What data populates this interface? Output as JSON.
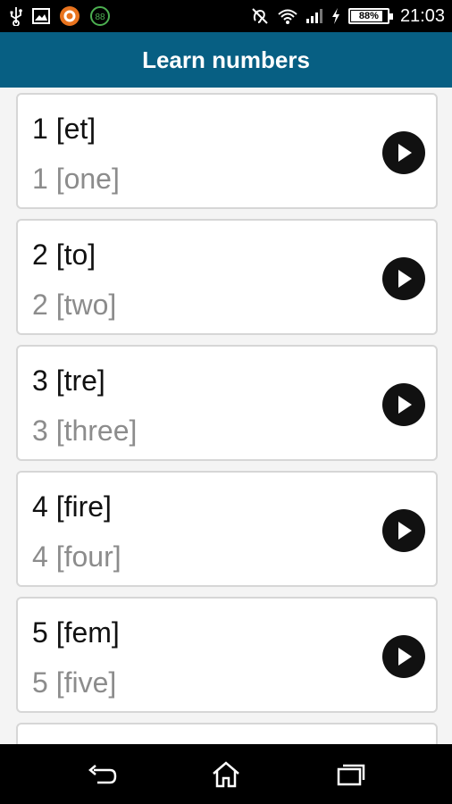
{
  "status_bar": {
    "battery": "88%",
    "battery_level": 0.88,
    "time": "21:03",
    "icons_left": [
      "usb-icon",
      "image-icon",
      "app-notification-icon",
      "download-icon"
    ],
    "icons_right": [
      "hearing-aid-icon",
      "wifi-icon",
      "signal-icon",
      "charging-icon",
      "battery-icon"
    ]
  },
  "app_bar": {
    "title": "Learn numbers"
  },
  "items": [
    {
      "native": "1 [et]",
      "english": "1 [one]"
    },
    {
      "native": "2 [to]",
      "english": "2 [two]"
    },
    {
      "native": "3 [tre]",
      "english": "3 [three]"
    },
    {
      "native": "4 [fire]",
      "english": "4 [four]"
    },
    {
      "native": "5 [fem]",
      "english": "5 [five]"
    }
  ],
  "nav_bar": {
    "buttons": [
      "back-icon",
      "home-icon",
      "recents-icon"
    ]
  },
  "colors": {
    "app_bar": "#075f83",
    "primary_text": "#111111",
    "secondary_text": "#8c8c8c"
  }
}
